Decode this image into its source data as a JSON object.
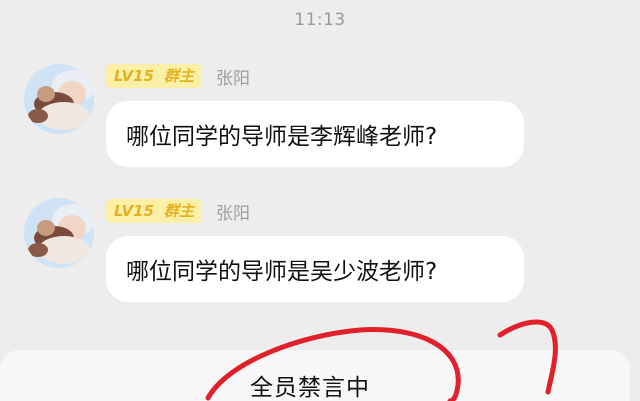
{
  "status": {
    "time": "11:13"
  },
  "messages": [
    {
      "level_badge": "LV15",
      "role_badge": "群主",
      "sender": "张阳",
      "text": "哪位同学的导师是李辉峰老师?"
    },
    {
      "level_badge": "LV15",
      "role_badge": "群主",
      "sender": "张阳",
      "text": "哪位同学的导师是吴少波老师?"
    }
  ],
  "footer": {
    "mute_status": "全员禁言中"
  },
  "colors": {
    "background": "#ededed",
    "bubble": "#ffffff",
    "badge_bg": "#fcefa8",
    "badge_text": "#e2b321",
    "annotation_red": "#e0202a"
  }
}
